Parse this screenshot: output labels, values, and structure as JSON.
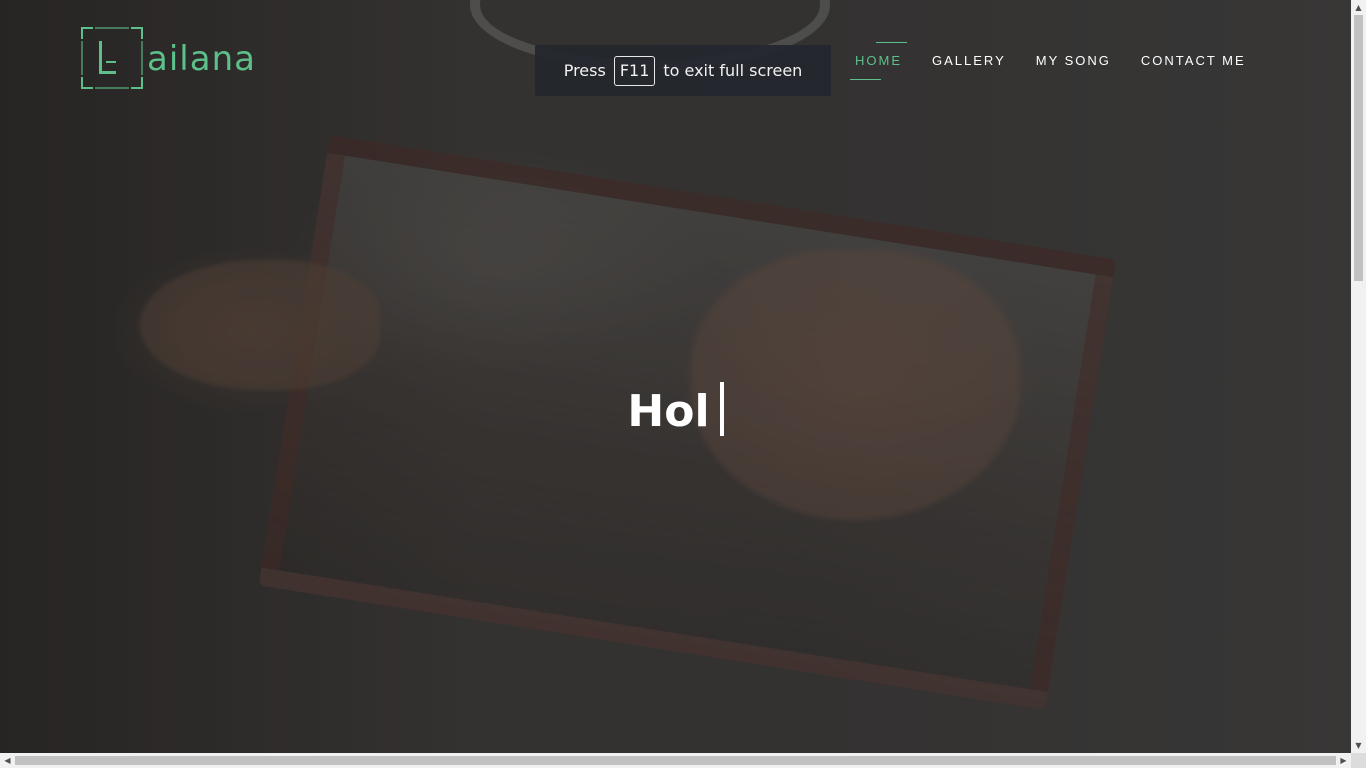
{
  "logo": {
    "text": "ailana",
    "color": "#5dbf8a"
  },
  "fullscreen_toast": {
    "prefix": "Press",
    "key": "F11",
    "suffix": "to exit full screen"
  },
  "nav": {
    "items": [
      {
        "label": "HOME",
        "active": true
      },
      {
        "label": "GALLERY",
        "active": false
      },
      {
        "label": "MY SONG",
        "active": false
      },
      {
        "label": "CONTACT ME",
        "active": false
      }
    ],
    "accent_color": "#5dbf8a"
  },
  "hero": {
    "typed_text": "Hol"
  },
  "icons": {
    "scroll_up": "triangle-up-icon",
    "scroll_down": "triangle-down-icon",
    "scroll_left": "triangle-left-icon",
    "scroll_right": "triangle-right-icon"
  }
}
